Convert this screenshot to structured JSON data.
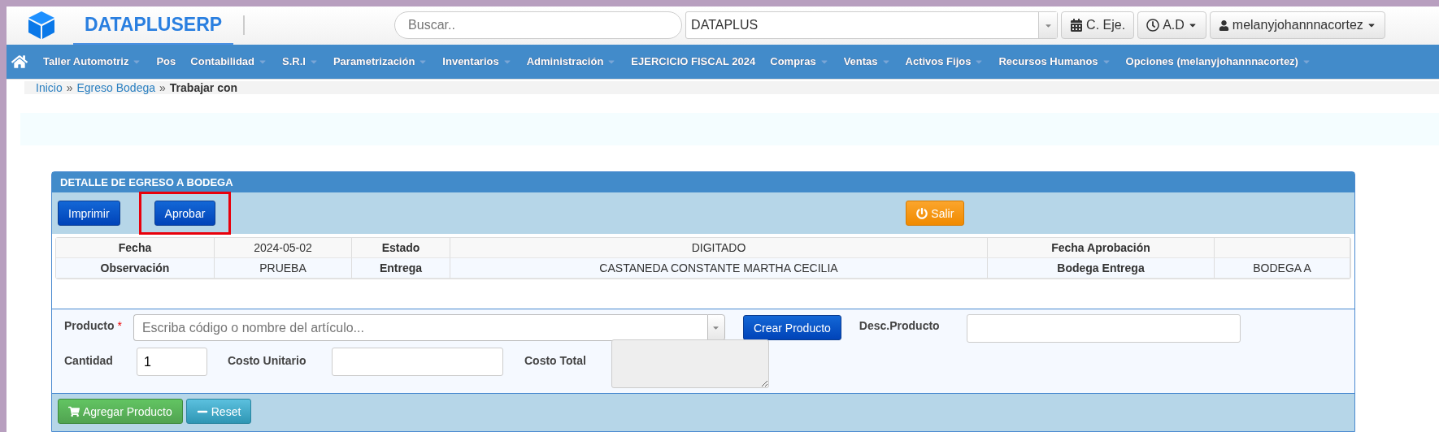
{
  "header": {
    "brand": "DATAPLUSERP",
    "search": {
      "placeholder": "Buscar.."
    },
    "company_select": {
      "value": "DATAPLUS"
    },
    "buttons": [
      {
        "kind": "calendar",
        "label": "C. Eje.",
        "dropdown": false
      },
      {
        "kind": "clock",
        "label": "A.D",
        "dropdown": true
      },
      {
        "kind": "user",
        "label": "melanyjohannnacortez",
        "dropdown": true
      }
    ]
  },
  "nav": {
    "items": [
      {
        "label": "Taller Automotriz",
        "dropdown": true
      },
      {
        "label": "Pos",
        "dropdown": false
      },
      {
        "label": "Contabilidad",
        "dropdown": true
      },
      {
        "label": "S.R.I",
        "dropdown": true
      },
      {
        "label": "Parametrización",
        "dropdown": true
      },
      {
        "label": "Inventarios",
        "dropdown": true
      },
      {
        "label": "Administración",
        "dropdown": true
      },
      {
        "label": "EJERCICIO FISCAL 2024",
        "dropdown": false
      },
      {
        "label": "Compras",
        "dropdown": true
      },
      {
        "label": "Ventas",
        "dropdown": true
      },
      {
        "label": "Activos Fijos",
        "dropdown": true
      },
      {
        "label": "Recursos Humanos",
        "dropdown": true
      },
      {
        "label": "Opciones (melanyjohannnacortez)",
        "dropdown": true
      }
    ]
  },
  "breadcrumb": [
    {
      "label": "Inicio",
      "current": false
    },
    {
      "separator": "»",
      "label": "Egreso Bodega",
      "current": false
    },
    {
      "separator": "»",
      "label": "Trabajar con",
      "current": true
    }
  ],
  "panel": {
    "title": "DETALLE DE EGRESO A BODEGA",
    "toolbar": [
      {
        "kind": "primary",
        "label": "Imprimir",
        "highlighted": false
      },
      {
        "kind": "primary",
        "label": "Aprobar",
        "highlighted": true
      },
      {
        "kind": "exit",
        "label": "Salir",
        "highlighted": false
      }
    ],
    "details": [
      [
        {
          "label": "Fecha",
          "value": "2024-05-02"
        },
        {
          "label": "Estado",
          "value": "DIGITADO"
        },
        {
          "label": "Fecha Aprobación"
        }
      ],
      [
        {
          "label": "Observación",
          "value": "PRUEBA"
        },
        {
          "label": "Entrega",
          "value": "CASTANEDA CONSTANTE MARTHA CECILIA"
        },
        {
          "label": "Bodega Entrega",
          "value": "BODEGA A"
        }
      ]
    ],
    "form": {
      "product": {
        "label": "Producto",
        "required_mark": "*",
        "placeholder": "Escriba código o nombre del artículo..."
      },
      "create_button": "Crear Producto",
      "description": {
        "label": "Desc.Producto"
      },
      "quantity": {
        "label": "Cantidad",
        "value": "1"
      },
      "unit_cost": {
        "label": "Costo Unitario"
      },
      "total_cost": {
        "label": "Costo Total",
        "disabled": true
      }
    },
    "actions": [
      {
        "kind": "add",
        "label": "Agregar Producto"
      },
      {
        "kind": "reset",
        "label": "Reset"
      }
    ]
  }
}
